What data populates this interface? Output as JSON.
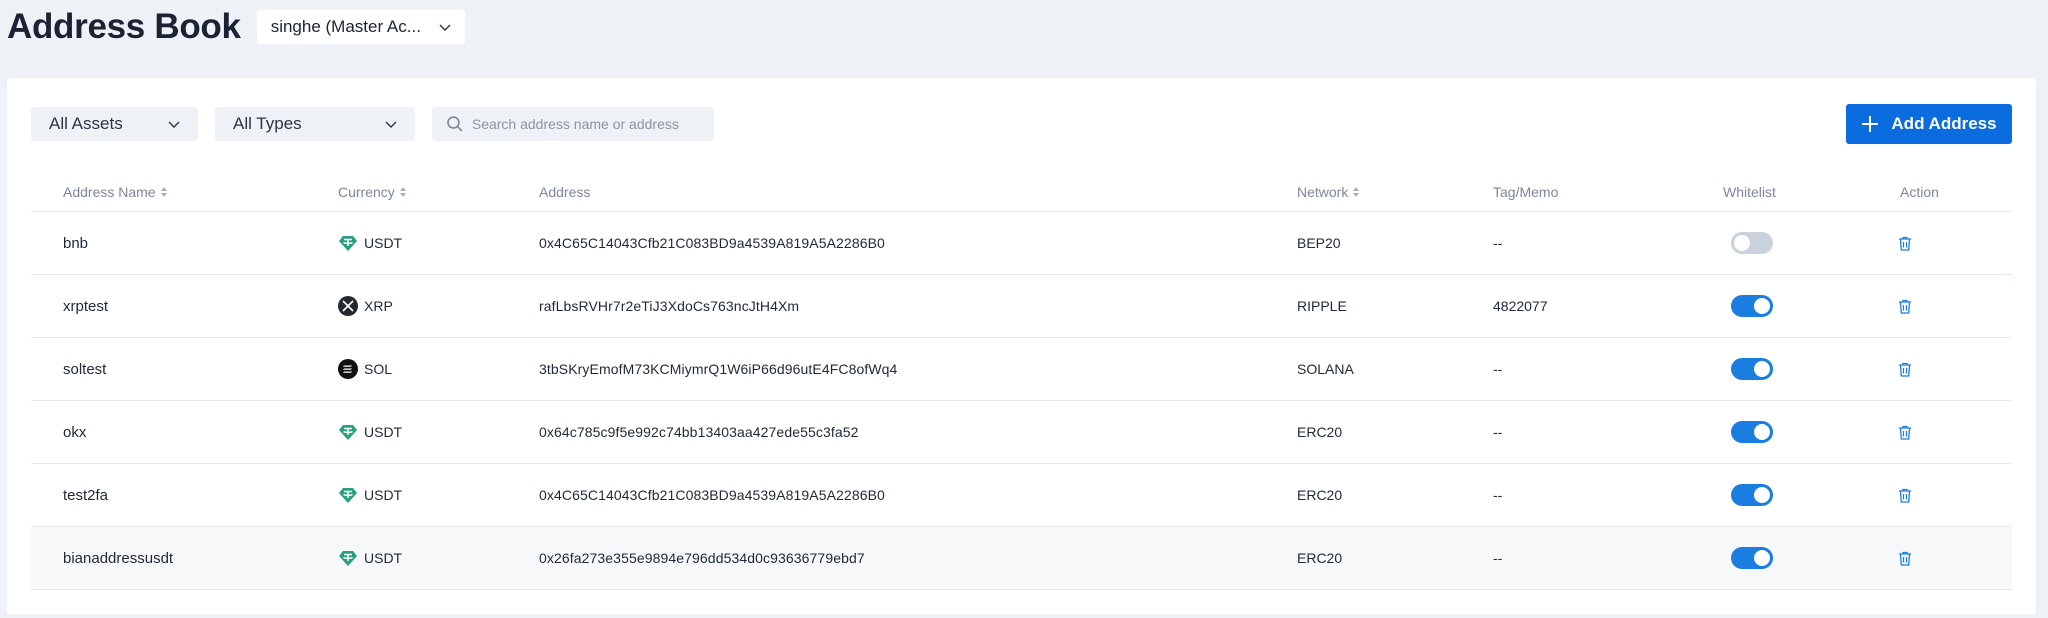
{
  "header": {
    "title": "Address Book",
    "account_label": "singhe (Master Ac..."
  },
  "filters": {
    "assets": "All Assets",
    "types": "All Types",
    "search_placeholder": "Search address name or address"
  },
  "add_button": "Add Address",
  "columns": {
    "name": "Address Name",
    "currency": "Currency",
    "address": "Address",
    "network": "Network",
    "tag": "Tag/Memo",
    "whitelist": "Whitelist",
    "action": "Action"
  },
  "rows": [
    {
      "name": "bnb",
      "currency": "USDT",
      "coin": "usdt",
      "address": "0x4C65C14043Cfb21C083BD9a4539A819A5A2286B0",
      "network": "BEP20",
      "tag": "--",
      "whitelist": false
    },
    {
      "name": "xrptest",
      "currency": "XRP",
      "coin": "xrp",
      "address": "rafLbsRVHr7r2eTiJ3XdoCs763ncJtH4Xm",
      "network": "RIPPLE",
      "tag": "4822077",
      "whitelist": true
    },
    {
      "name": "soltest",
      "currency": "SOL",
      "coin": "sol",
      "address": "3tbSKryEmofM73KCMiymrQ1W6iP66d96utE4FC8ofWq4",
      "network": "SOLANA",
      "tag": "--",
      "whitelist": true
    },
    {
      "name": "okx",
      "currency": "USDT",
      "coin": "usdt",
      "address": "0x64c785c9f5e992c74bb13403aa427ede55c3fa52",
      "network": "ERC20",
      "tag": "--",
      "whitelist": true
    },
    {
      "name": "test2fa",
      "currency": "USDT",
      "coin": "usdt",
      "address": "0x4C65C14043Cfb21C083BD9a4539A819A5A2286B0",
      "network": "ERC20",
      "tag": "--",
      "whitelist": true
    },
    {
      "name": "bianaddressusdt",
      "currency": "USDT",
      "coin": "usdt",
      "address": "0x26fa273e355e9894e796dd534d0c93636779ebd7",
      "network": "ERC20",
      "tag": "--",
      "whitelist": true
    }
  ],
  "colors": {
    "primary": "#0a6cdf",
    "toggle_on": "#1a7de0",
    "toggle_off": "#c9d1db",
    "usdt": "#26a17b",
    "trash": "#1a7de0"
  }
}
